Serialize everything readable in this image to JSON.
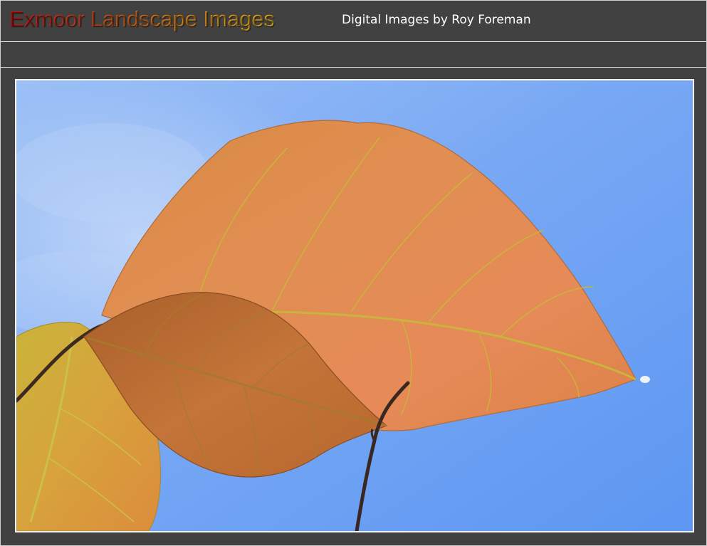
{
  "header": {
    "title": "Exmoor Landscape Images",
    "subtitle": "Digital Images by Roy Foreman"
  },
  "colors": {
    "background": "#414141",
    "rule": "#e6e6e6",
    "title_gradient": [
      "#d01010",
      "#f08a16",
      "#f6c020"
    ],
    "subtitle": "#ffffff",
    "sky": "#6fa2f4",
    "leaf_main": "#e08a4c",
    "leaf_small": "#c8743c",
    "leaf_yellow": "#d0b238"
  },
  "photo": {
    "subject": "backlit beech leaves against blue sky"
  }
}
